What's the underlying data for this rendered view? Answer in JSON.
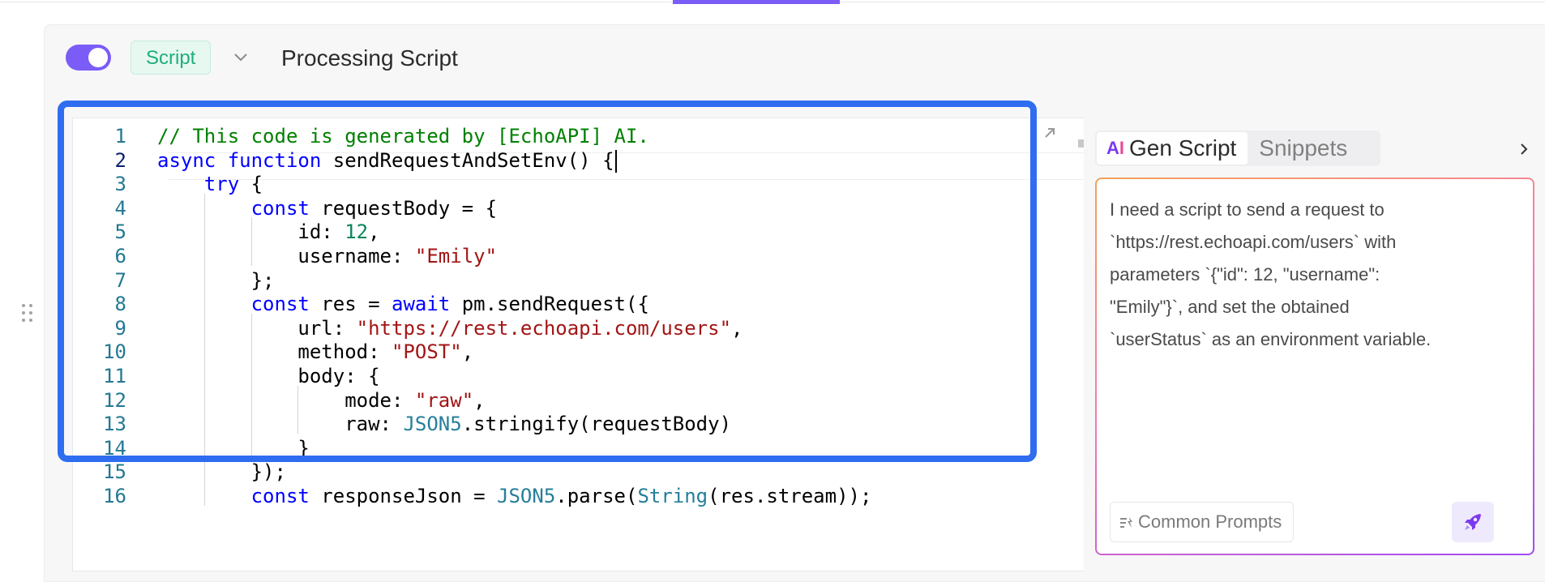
{
  "header": {
    "toggle_on": true,
    "badge_label": "Script",
    "title": "Processing Script"
  },
  "editor": {
    "line_numbers": [
      "1",
      "2",
      "3",
      "4",
      "5",
      "6",
      "7",
      "8",
      "9",
      "10",
      "11",
      "12",
      "13",
      "14",
      "15",
      "16"
    ],
    "lines": [
      {
        "indent": 0,
        "tokens": [
          {
            "t": "// This code is generated by [EchoAPI] AI.",
            "c": "c"
          }
        ]
      },
      {
        "indent": 0,
        "tokens": [
          {
            "t": "async",
            "c": "k"
          },
          {
            "t": " "
          },
          {
            "t": "function",
            "c": "k"
          },
          {
            "t": " sendRequestAndSetEnv() {"
          }
        ]
      },
      {
        "indent": 1,
        "tokens": [
          {
            "t": "try",
            "c": "k"
          },
          {
            "t": " {"
          }
        ]
      },
      {
        "indent": 2,
        "tokens": [
          {
            "t": "const",
            "c": "k"
          },
          {
            "t": " requestBody = {"
          }
        ]
      },
      {
        "indent": 3,
        "tokens": [
          {
            "t": "id: "
          },
          {
            "t": "12",
            "c": "n"
          },
          {
            "t": ","
          }
        ]
      },
      {
        "indent": 3,
        "tokens": [
          {
            "t": "username: "
          },
          {
            "t": "\"Emily\"",
            "c": "s"
          }
        ]
      },
      {
        "indent": 2,
        "tokens": [
          {
            "t": "};"
          }
        ]
      },
      {
        "indent": 2,
        "tokens": [
          {
            "t": "const",
            "c": "k"
          },
          {
            "t": " res = "
          },
          {
            "t": "await",
            "c": "k"
          },
          {
            "t": " pm.sendRequest({"
          }
        ]
      },
      {
        "indent": 3,
        "tokens": [
          {
            "t": "url: "
          },
          {
            "t": "\"https://rest.echoapi.com/users\"",
            "c": "s"
          },
          {
            "t": ","
          }
        ]
      },
      {
        "indent": 3,
        "tokens": [
          {
            "t": "method: "
          },
          {
            "t": "\"POST\"",
            "c": "s"
          },
          {
            "t": ","
          }
        ]
      },
      {
        "indent": 3,
        "tokens": [
          {
            "t": "body: {"
          }
        ]
      },
      {
        "indent": 4,
        "tokens": [
          {
            "t": "mode: "
          },
          {
            "t": "\"raw\"",
            "c": "s"
          },
          {
            "t": ","
          }
        ]
      },
      {
        "indent": 4,
        "tokens": [
          {
            "t": "raw: "
          },
          {
            "t": "JSON5",
            "c": "t"
          },
          {
            "t": ".stringify(requestBody)"
          }
        ]
      },
      {
        "indent": 3,
        "tokens": [
          {
            "t": "}"
          }
        ]
      },
      {
        "indent": 2,
        "tokens": [
          {
            "t": "});"
          }
        ]
      },
      {
        "indent": 2,
        "tokens": [
          {
            "t": "const",
            "c": "k"
          },
          {
            "t": " responseJson = "
          },
          {
            "t": "JSON5",
            "c": "t"
          },
          {
            "t": ".parse("
          },
          {
            "t": "String",
            "c": "t"
          },
          {
            "t": "(res.stream));"
          }
        ]
      }
    ]
  },
  "side_panel": {
    "tabs": [
      {
        "label": "Gen Script",
        "active": true,
        "icon": "ai-icon"
      },
      {
        "label": "Snippets",
        "active": false
      }
    ],
    "prompt_lines": [
      "I need a script to send a request to",
      "`https://rest.echoapi.com/users` with",
      "parameters `{\"id\": 12, \"username\":",
      "\"Emily\"}`, and set the obtained",
      "`userStatus` as an environment variable."
    ],
    "common_prompts_label": "Common Prompts",
    "send_icon": "rocket-icon"
  },
  "colors": {
    "accent": "#7c5cf6",
    "highlight": "#2f6df0",
    "badge_text": "#1fae7a"
  }
}
